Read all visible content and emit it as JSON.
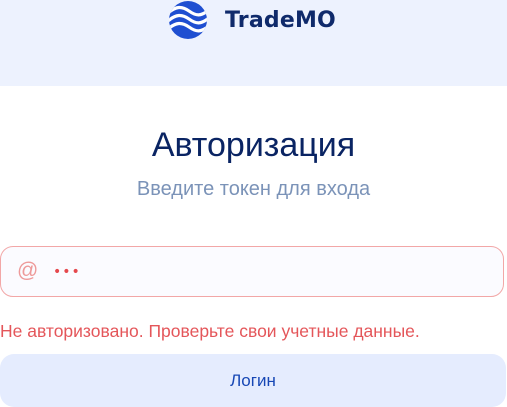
{
  "brand": {
    "name": "TradeMO",
    "logo_icon": "wave-circle-logo",
    "color": "#0f2a6b"
  },
  "auth": {
    "title": "Авторизация",
    "subtitle": "Введите токен для входа",
    "token_field": {
      "icon": "at-sign-icon",
      "value": "•••"
    },
    "error_message": "Не авторизовано. Проверьте свои учетные данные.",
    "login_button_label": "Логин"
  },
  "colors": {
    "header_bg": "#edf2fe",
    "title": "#0a2463",
    "subtitle": "#7b93b8",
    "error": "#e4565a",
    "error_border": "#f2a7a7",
    "button_bg": "#e5ecfe",
    "button_text": "#1747b5"
  }
}
